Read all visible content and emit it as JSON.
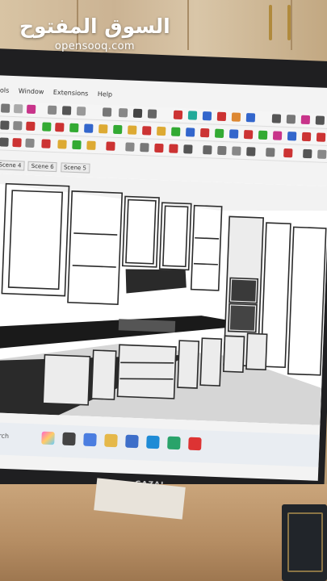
{
  "watermark": {
    "arabic": "السوق المفتوح",
    "latin": "opensooq.com"
  },
  "app": {
    "menu": [
      "ols",
      "Window",
      "Extensions",
      "Help"
    ],
    "scenes": [
      "Scene 4",
      "Scene 6",
      "Scene 5"
    ]
  },
  "taskbar": {
    "search": "Search"
  },
  "monitor": {
    "brand": "GAZAL"
  },
  "colors": {
    "screen_bg": "#f3f3f3",
    "bezel": "#1f1f21",
    "model_lines": "#2b2b2b",
    "floor": "#d6d6d6",
    "countertop": "#1a1a1a"
  }
}
